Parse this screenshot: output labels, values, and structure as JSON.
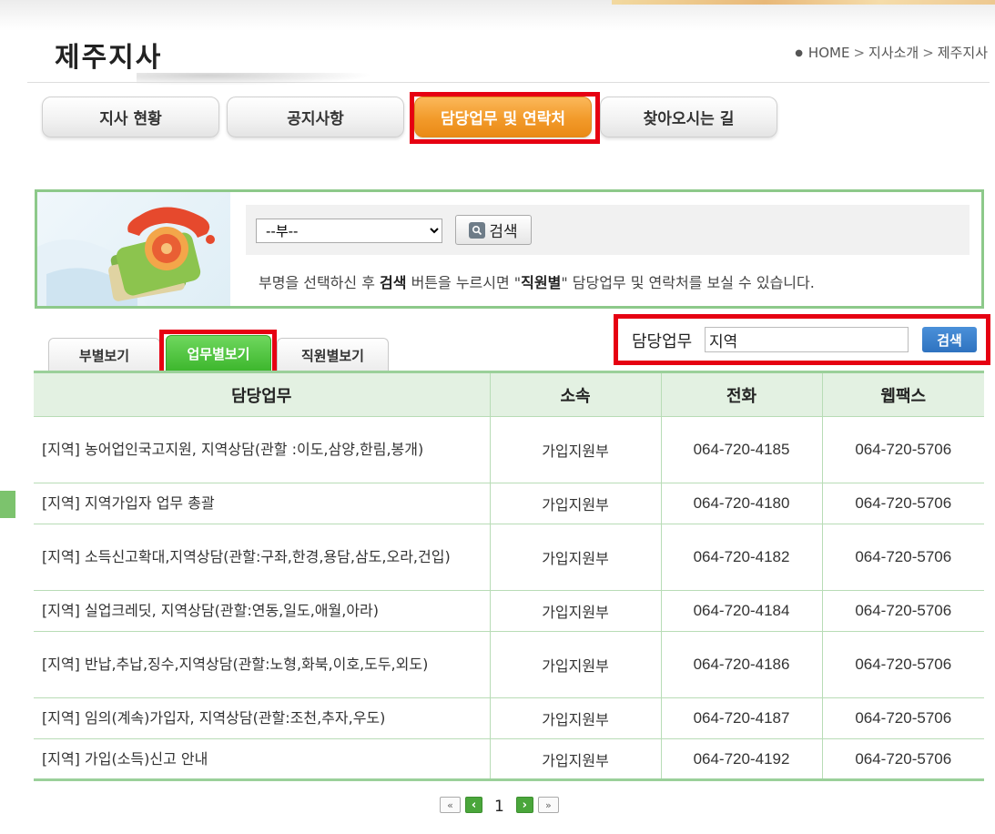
{
  "header": {
    "title": "제주지사",
    "breadcrumb": [
      "HOME",
      "지사소개",
      "제주지사"
    ]
  },
  "main_tabs": [
    {
      "label": "지사 현황",
      "active": false
    },
    {
      "label": "공지사항",
      "active": false
    },
    {
      "label": "담당업무 및 연락처",
      "active": true
    },
    {
      "label": "찾아오시는 길",
      "active": false
    }
  ],
  "dept_search": {
    "select_value": "--부--",
    "button_label": "검색",
    "info_parts": [
      "부명을 선택하신 후 ",
      "검색",
      " 버튼을 누르시면 \"",
      "직원별",
      "\" 담당업무 및 연락처를 보실 수 있습니다."
    ]
  },
  "sub_tabs": [
    {
      "label": "부별보기",
      "active": false
    },
    {
      "label": "업무별보기",
      "active": true
    },
    {
      "label": "직원별보기",
      "active": false
    }
  ],
  "task_search": {
    "label": "담당업무",
    "value": "지역",
    "button_label": "검색"
  },
  "table": {
    "headers": [
      "담당업무",
      "소속",
      "전화",
      "웹팩스"
    ],
    "rows": [
      {
        "task": "[지역] 농어업인국고지원, 지역상담(관할 :이도,삼양,한림,봉개)",
        "dept": "가입지원부",
        "phone": "064-720-4185",
        "fax": "064-720-5706"
      },
      {
        "task": "[지역] 지역가입자 업무 총괄",
        "dept": "가입지원부",
        "phone": "064-720-4180",
        "fax": "064-720-5706"
      },
      {
        "task": "[지역] 소득신고확대,지역상담(관할:구좌,한경,용담,삼도,오라,건입)",
        "dept": "가입지원부",
        "phone": "064-720-4182",
        "fax": "064-720-5706"
      },
      {
        "task": "[지역] 실업크레딧, 지역상담(관할:연동,일도,애월,아라)",
        "dept": "가입지원부",
        "phone": "064-720-4184",
        "fax": "064-720-5706"
      },
      {
        "task": "[지역] 반납,추납,징수,지역상담(관할:노형,화북,이호,도두,외도)",
        "dept": "가입지원부",
        "phone": "064-720-4186",
        "fax": "064-720-5706"
      },
      {
        "task": "[지역] 임의(계속)가입자, 지역상담(관할:조천,추자,우도)",
        "dept": "가입지원부",
        "phone": "064-720-4187",
        "fax": "064-720-5706"
      },
      {
        "task": "[지역] 가입(소득)신고 안내",
        "dept": "가입지원부",
        "phone": "064-720-4192",
        "fax": "064-720-5706"
      }
    ]
  },
  "pagination": {
    "current": "1"
  },
  "colors": {
    "accent_orange": "#f29a2a",
    "accent_green": "#3cb62c",
    "table_border": "#9bd09a",
    "highlight_red": "#e60012",
    "search_blue": "#2f73c0"
  }
}
